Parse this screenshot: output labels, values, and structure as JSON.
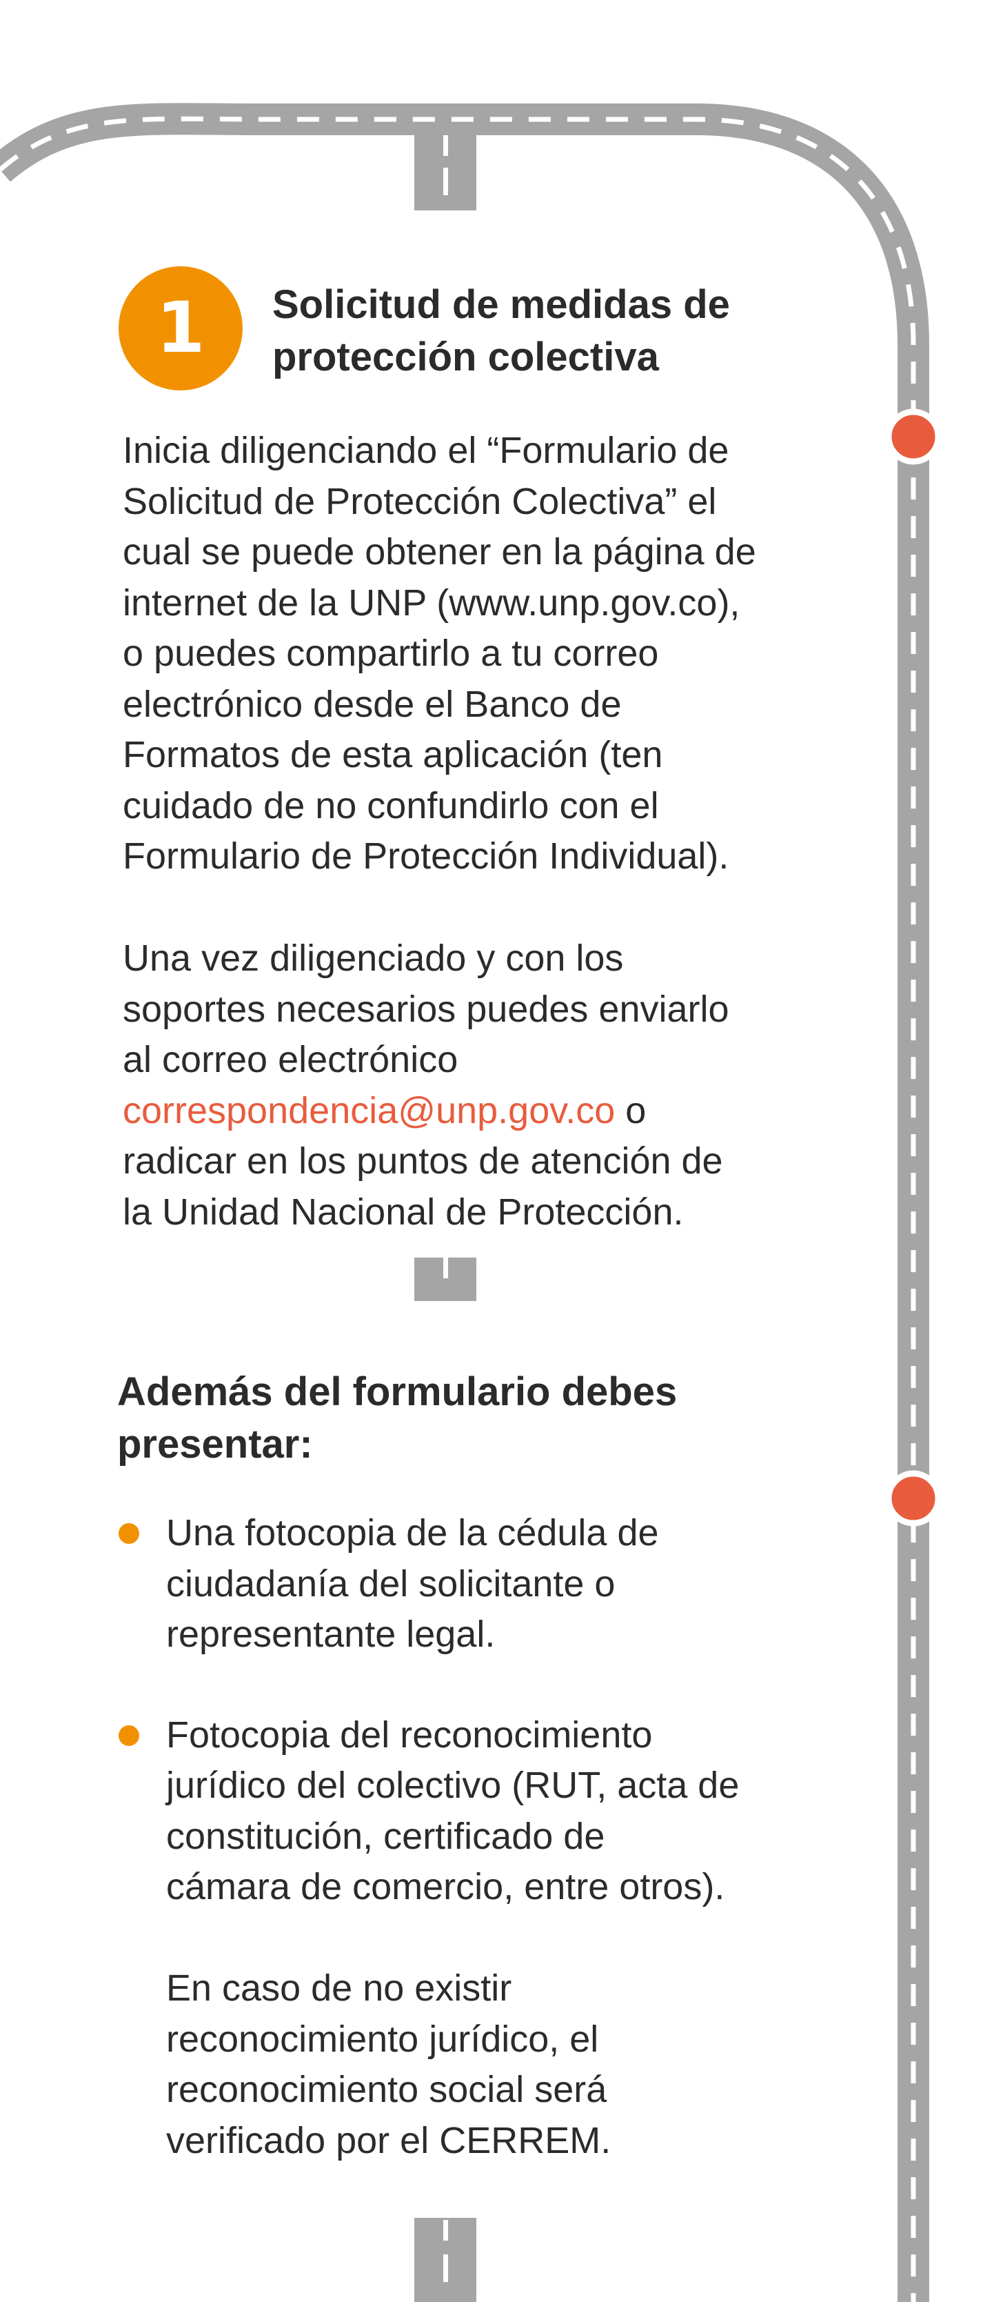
{
  "colors": {
    "road": "#a5a5a5",
    "lane_marking": "#ffffff",
    "step_badge": "#f29100",
    "bullet": "#f29100",
    "marker": "#e85c3d",
    "email": "#e85c3d",
    "text": "#2b2b2b"
  },
  "step": {
    "number": "1",
    "title_line1": "Solicitud de medidas de",
    "title_line2": "protección colectiva"
  },
  "intro": {
    "lines": [
      "Inicia diligenciando el “Formulario de",
      "Solicitud de Protección Colectiva” el",
      "cual se puede obtener en la página de",
      "internet de la UNP (www.unp.gov.co),",
      "o puedes compartirlo a tu correo",
      "electrónico desde el Banco de",
      "Formatos de esta aplicación (ten",
      "cuidado de no confundirlo con el",
      "Formulario de Protección Individual)."
    ]
  },
  "submission": {
    "line1": "Una vez diligenciado y con los",
    "line2": "soportes necesarios puedes enviarlo",
    "line3": "al correo electrónico",
    "email": "correspondencia@unp.gov.co",
    "connector": " o",
    "line5": "radicar en los puntos de atención de",
    "line6": "la Unidad Nacional de Protección."
  },
  "requirements": {
    "title_line1": "Además del formulario debes",
    "title_line2": "presentar:",
    "items": [
      {
        "lines": [
          "Una fotocopia de la cédula de",
          "ciudadanía del solicitante o",
          "representante legal."
        ]
      },
      {
        "lines": [
          "Fotocopia del reconocimiento",
          "jurídico del colectivo (RUT, acta de",
          "constitución, certificado de",
          "cámara de comercio, entre otros)."
        ],
        "note_lines": [
          "En caso de no existir",
          "reconocimiento jurídico, el",
          "reconocimiento social será",
          "verificado por el CERREM."
        ]
      }
    ]
  }
}
